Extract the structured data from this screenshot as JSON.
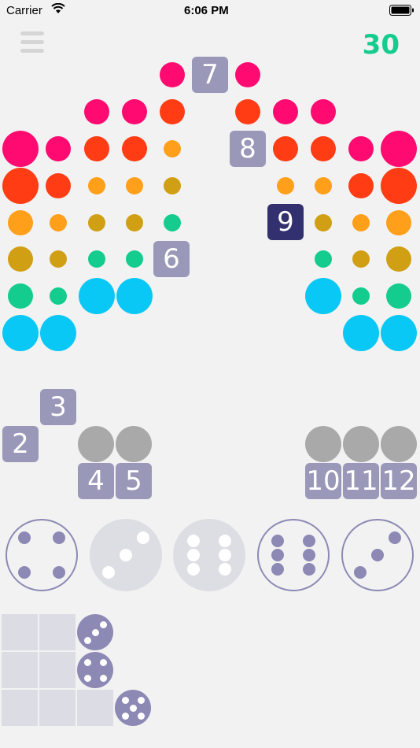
{
  "status_bar": {
    "carrier": "Carrier",
    "time": "6:06 PM"
  },
  "header": {
    "score": "30"
  },
  "colors": {
    "pink": "#ff0a70",
    "red": "#ff3c14",
    "orange": "#ff9f1a",
    "gold": "#d19f14",
    "teal": "#14cc8e",
    "cyan": "#0ac8f5",
    "tile": "#9a98b8",
    "tile_active": "#33306f",
    "die": "#8c89b4"
  },
  "board": {
    "tiles": {
      "t7": "7",
      "t8": "8",
      "t9": "9",
      "t6": "6"
    }
  },
  "bins": {
    "t2": "2",
    "t3": "3",
    "t4": "4",
    "t5": "5",
    "t10": "10",
    "t11": "11",
    "t12": "12"
  },
  "dice": [
    {
      "value": 4,
      "state": "available"
    },
    {
      "value": 3,
      "state": "used"
    },
    {
      "value": 6,
      "state": "used"
    },
    {
      "value": 6,
      "state": "available"
    },
    {
      "value": 3,
      "state": "available"
    }
  ],
  "tray": {
    "mini_dice": [
      3,
      4,
      5
    ]
  }
}
